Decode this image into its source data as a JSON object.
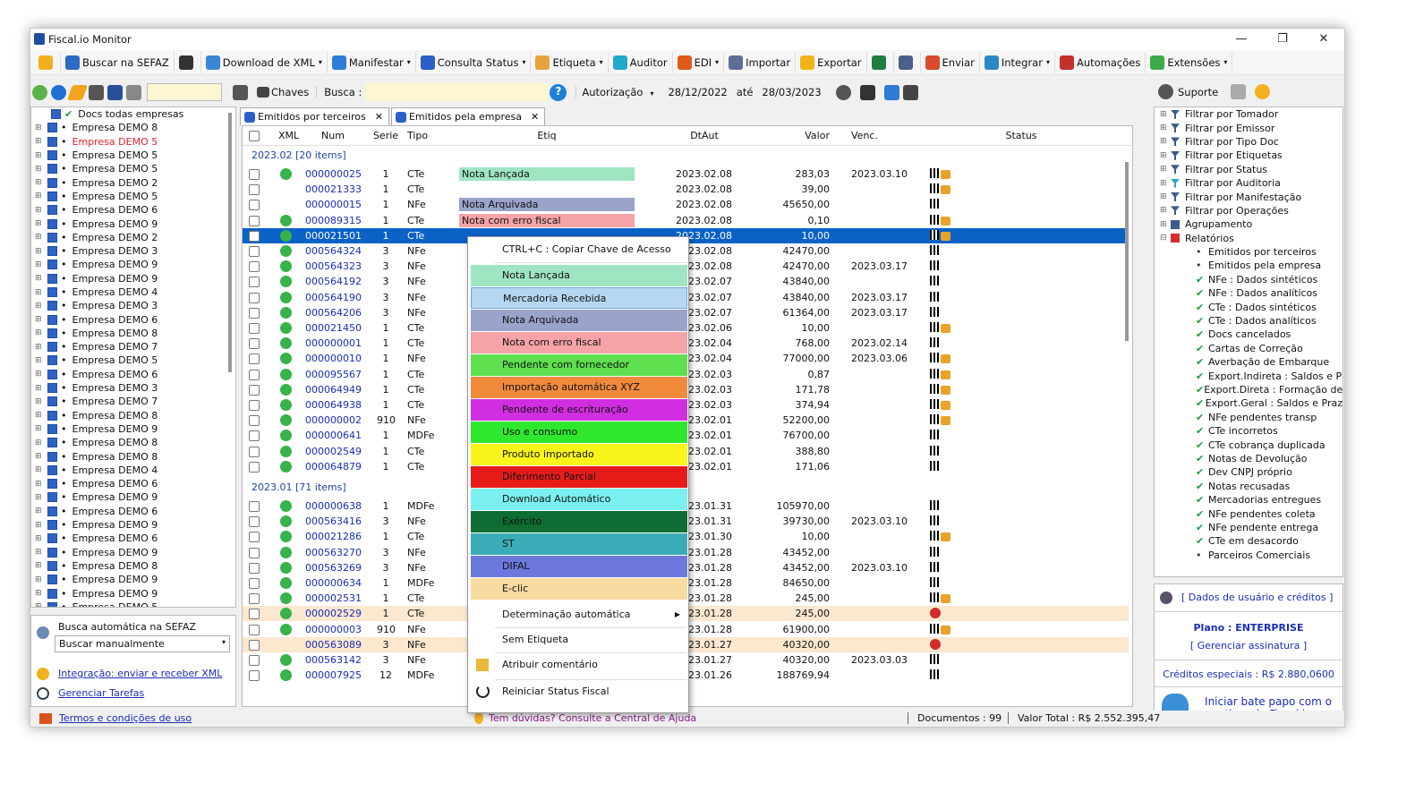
{
  "window": {
    "title": "Fiscal.io Monitor",
    "controls": [
      "—",
      "❐",
      "✕"
    ]
  },
  "toolbar": [
    {
      "label": "",
      "icon": "sun-icon",
      "color": "#f2b01e"
    },
    {
      "label": "Buscar na SEFAZ",
      "icon": "globe-search-icon",
      "color": "#2b6cc4"
    },
    {
      "label": "",
      "icon": "list-icon",
      "color": "#333"
    },
    {
      "label": "Download de XML",
      "icon": "xml-icon",
      "color": "#3a86d4",
      "dd": "▾"
    },
    {
      "label": "Manifestar",
      "icon": "manifest-icon",
      "color": "#2d7cd6",
      "dd": "▾"
    },
    {
      "label": "Consulta Status",
      "icon": "check-status-icon",
      "color": "#2b5fc7",
      "dd": "▾"
    },
    {
      "label": "Etiqueta",
      "icon": "tag-icon",
      "color": "#e8a33d",
      "dd": "▾"
    },
    {
      "label": "Auditor",
      "icon": "auditor-icon",
      "color": "#22a8c9"
    },
    {
      "label": "EDI",
      "icon": "truck-icon",
      "color": "#e05a1b",
      "dd": "▾"
    },
    {
      "label": "Importar",
      "icon": "import-icon",
      "color": "#5c6d9a"
    },
    {
      "label": "Exportar",
      "icon": "export-icon",
      "color": "#f0b41a"
    },
    {
      "label": "",
      "icon": "excel-icon",
      "color": "#1e7d3f"
    },
    {
      "label": "",
      "icon": "printer-icon",
      "color": "#4a5f8a"
    },
    {
      "label": "Enviar",
      "icon": "envelope-icon",
      "color": "#d94b2b"
    },
    {
      "label": "Integrar",
      "icon": "gear-icon",
      "color": "#2b8ac4",
      "dd": "▾"
    },
    {
      "label": "Automações",
      "icon": "automation-icon",
      "color": "#c4302b"
    },
    {
      "label": "Extensões",
      "icon": "extension-icon",
      "color": "#3cab4a",
      "dd": "▾"
    }
  ],
  "toolbar2": {
    "chaves": "Chaves",
    "busca_label": "Busca :",
    "filter": "Autorização",
    "date_from": "28/12/2022",
    "ate": "até",
    "date_to": "28/03/2023",
    "suporte": "Suporte"
  },
  "tabs": [
    {
      "label": "Emitidos por terceiros",
      "close": "✕"
    },
    {
      "label": "Emitidos pela empresa",
      "close": "✕"
    }
  ],
  "left_tree": {
    "root": "Docs todas empresas",
    "items": [
      "Empresa DEMO 8",
      "Empresa DEMO 5",
      "Empresa DEMO 5",
      "Empresa DEMO 5",
      "Empresa DEMO 2",
      "Empresa DEMO 5",
      "Empresa DEMO 6",
      "Empresa DEMO 9",
      "Empresa DEMO 2",
      "Empresa DEMO 3",
      "Empresa DEMO 9",
      "Empresa DEMO 9",
      "Empresa DEMO 4",
      "Empresa DEMO 3",
      "Empresa DEMO 6",
      "Empresa DEMO 8",
      "Empresa DEMO 7",
      "Empresa DEMO 5",
      "Empresa DEMO 6",
      "Empresa DEMO 3",
      "Empresa DEMO 7",
      "Empresa DEMO 8",
      "Empresa DEMO 9",
      "Empresa DEMO 8",
      "Empresa DEMO 8",
      "Empresa DEMO 4",
      "Empresa DEMO 6",
      "Empresa DEMO 9",
      "Empresa DEMO 6",
      "Empresa DEMO 9",
      "Empresa DEMO 6",
      "Empresa DEMO 9",
      "Empresa DEMO 8",
      "Empresa DEMO 9",
      "Empresa DEMO 9",
      "Empresa DEMO 5"
    ],
    "highlight_index": 1,
    "highlight_color": "#e8202a"
  },
  "left_bottom": {
    "auto_label": "Busca automática na SEFAZ",
    "auto_value": "Buscar manualmente",
    "integration": "Integração: enviar e receber XML",
    "tasks": "Gerenciar Tarefas"
  },
  "grid": {
    "columns": [
      "XML",
      "Num",
      "Serie",
      "Tipo",
      "Etiq",
      "DtAut",
      "Valor",
      "Venc.",
      "Status"
    ],
    "groups": [
      {
        "label": "2023.02 [20 items]",
        "rows": [
          {
            "num": "000000025",
            "serie": "1",
            "tipo": "CTe",
            "etiq": "Nota Lançada",
            "etiq_color": "#9fe5c2",
            "dt": "2023.02.08",
            "valor": "283,03",
            "venc": "2023.03.10",
            "xml": true,
            "status": "flag-truck"
          },
          {
            "num": "000021333",
            "serie": "1",
            "tipo": "CTe",
            "etiq": "",
            "dt": "2023.02.08",
            "valor": "39,00",
            "venc": "",
            "xml": false,
            "status": "flag-truck"
          },
          {
            "num": "000000015",
            "serie": "1",
            "tipo": "NFe",
            "etiq": "Nota Arquivada",
            "etiq_color": "#9aa3c9",
            "dt": "2023.02.08",
            "valor": "45650,00",
            "venc": "",
            "xml": false,
            "status": "flag"
          },
          {
            "num": "000089315",
            "serie": "1",
            "tipo": "CTe",
            "etiq": "Nota com erro fiscal",
            "etiq_color": "#f5a3a6",
            "dt": "2023.02.08",
            "valor": "0,10",
            "venc": "",
            "xml": true,
            "status": "flag-truck"
          },
          {
            "num": "000021501",
            "serie": "1",
            "tipo": "CTe",
            "etiq": "",
            "dt": "2023.02.08",
            "valor": "10,00",
            "venc": "",
            "xml": true,
            "status": "flag-truck",
            "selected": true
          },
          {
            "num": "000564324",
            "serie": "3",
            "tipo": "NFe",
            "etiq": "",
            "dt": "2023.02.08",
            "valor": "42470,00",
            "venc": "",
            "xml": true,
            "status": "flag"
          },
          {
            "num": "000564323",
            "serie": "3",
            "tipo": "NFe",
            "etiq": "",
            "dt": "2023.02.08",
            "valor": "42470,00",
            "venc": "2023.03.17",
            "xml": true,
            "status": "flag"
          },
          {
            "num": "000564192",
            "serie": "3",
            "tipo": "NFe",
            "etiq": "",
            "dt": "2023.02.07",
            "valor": "43840,00",
            "venc": "",
            "xml": true,
            "status": "flag"
          },
          {
            "num": "000564190",
            "serie": "3",
            "tipo": "NFe",
            "etiq": "",
            "dt": "2023.02.07",
            "valor": "43840,00",
            "venc": "2023.03.17",
            "xml": true,
            "status": "flag"
          },
          {
            "num": "000564206",
            "serie": "3",
            "tipo": "NFe",
            "etiq": "",
            "dt": "2023.02.07",
            "valor": "61364,00",
            "venc": "2023.03.17",
            "xml": true,
            "status": "flag"
          },
          {
            "num": "000021450",
            "serie": "1",
            "tipo": "CTe",
            "etiq": "",
            "dt": "2023.02.06",
            "valor": "10,00",
            "venc": "",
            "xml": true,
            "status": "flag-truck"
          },
          {
            "num": "000000001",
            "serie": "1",
            "tipo": "CTe",
            "etiq": "",
            "dt": "2023.02.04",
            "valor": "768,00",
            "venc": "2023.02.14",
            "xml": true,
            "status": "flag"
          },
          {
            "num": "000000010",
            "serie": "1",
            "tipo": "NFe",
            "etiq": "",
            "dt": "2023.02.04",
            "valor": "77000,00",
            "venc": "2023.03.06",
            "xml": true,
            "status": "flag-truck"
          },
          {
            "num": "000095567",
            "serie": "1",
            "tipo": "CTe",
            "etiq": "",
            "dt": "2023.02.03",
            "valor": "0,87",
            "venc": "",
            "xml": true,
            "status": "flag-truck"
          },
          {
            "num": "000064949",
            "serie": "1",
            "tipo": "CTe",
            "etiq": "",
            "dt": "2023.02.03",
            "valor": "171,78",
            "venc": "",
            "xml": true,
            "status": "flag-truck"
          },
          {
            "num": "000064938",
            "serie": "1",
            "tipo": "CTe",
            "etiq": "",
            "dt": "2023.02.03",
            "valor": "374,94",
            "venc": "",
            "xml": true,
            "status": "flag-truck"
          },
          {
            "num": "000000002",
            "serie": "910",
            "tipo": "NFe",
            "etiq": "",
            "dt": "2023.02.01",
            "valor": "52200,00",
            "venc": "",
            "xml": true,
            "status": "flag-truck"
          },
          {
            "num": "000000641",
            "serie": "1",
            "tipo": "MDFe",
            "etiq": "",
            "dt": "2023.02.01",
            "valor": "76700,00",
            "venc": "",
            "xml": true,
            "status": "flag"
          },
          {
            "num": "000002549",
            "serie": "1",
            "tipo": "CTe",
            "etiq": "",
            "dt": "2023.02.01",
            "valor": "388,80",
            "venc": "",
            "xml": true,
            "status": "flag"
          },
          {
            "num": "000064879",
            "serie": "1",
            "tipo": "CTe",
            "etiq": "",
            "dt": "2023.02.01",
            "valor": "171,06",
            "venc": "",
            "xml": true,
            "status": "flag"
          }
        ]
      },
      {
        "label": "2023.01 [71 items]",
        "rows": [
          {
            "num": "000000638",
            "serie": "1",
            "tipo": "MDFe",
            "etiq": "",
            "dt": "2023.01.31",
            "valor": "105970,00",
            "venc": "",
            "xml": true,
            "status": "flag"
          },
          {
            "num": "000563416",
            "serie": "3",
            "tipo": "NFe",
            "etiq": "",
            "dt": "2023.01.31",
            "valor": "39730,00",
            "venc": "2023.03.10",
            "xml": true,
            "status": "flag"
          },
          {
            "num": "000021286",
            "serie": "1",
            "tipo": "CTe",
            "etiq": "",
            "dt": "2023.01.30",
            "valor": "10,00",
            "venc": "",
            "xml": true,
            "status": "flag-truck"
          },
          {
            "num": "000563270",
            "serie": "3",
            "tipo": "NFe",
            "etiq": "",
            "dt": "2023.01.28",
            "valor": "43452,00",
            "venc": "",
            "xml": true,
            "status": "flag"
          },
          {
            "num": "000563269",
            "serie": "3",
            "tipo": "NFe",
            "etiq": "",
            "dt": "2023.01.28",
            "valor": "43452,00",
            "venc": "2023.03.10",
            "xml": true,
            "status": "flag"
          },
          {
            "num": "000000634",
            "serie": "1",
            "tipo": "MDFe",
            "etiq": "",
            "dt": "2023.01.28",
            "valor": "84650,00",
            "venc": "",
            "xml": true,
            "status": "flag"
          },
          {
            "num": "000002531",
            "serie": "1",
            "tipo": "CTe",
            "etiq": "",
            "dt": "2023.01.28",
            "valor": "245,00",
            "venc": "",
            "xml": true,
            "status": "flag-truck"
          },
          {
            "num": "000002529",
            "serie": "1",
            "tipo": "CTe",
            "etiq": "",
            "dt": "2023.01.28",
            "valor": "245,00",
            "venc": "",
            "xml": true,
            "status": "error",
            "hl": true
          },
          {
            "num": "000000003",
            "serie": "910",
            "tipo": "NFe",
            "etiq": "",
            "dt": "2023.01.28",
            "valor": "61900,00",
            "venc": "",
            "xml": true,
            "status": "flag-truck"
          },
          {
            "num": "000563089",
            "serie": "3",
            "tipo": "NFe",
            "etiq": "",
            "dt": "2023.01.27",
            "valor": "40320,00",
            "venc": "",
            "xml": false,
            "status": "error",
            "hl": true
          },
          {
            "num": "000563142",
            "serie": "3",
            "tipo": "NFe",
            "etiq": "",
            "dt": "2023.01.27",
            "valor": "40320,00",
            "venc": "2023.03.03",
            "xml": true,
            "status": "flag"
          },
          {
            "num": "000007925",
            "serie": "12",
            "tipo": "MDFe",
            "etiq": "",
            "dt": "2023.01.26",
            "valor": "188769,94",
            "venc": "",
            "xml": true,
            "status": "flag"
          }
        ]
      }
    ]
  },
  "context_menu": {
    "copy": "CTRL+C : Copiar Chave de Acesso",
    "labels": [
      {
        "text": "Nota Lançada",
        "color": "#9fe5c2"
      },
      {
        "text": "Mercadoria Recebida",
        "color": "#b6d6f2"
      },
      {
        "text": "Nota Arquivada",
        "color": "#9aa3c9"
      },
      {
        "text": "Nota com erro fiscal",
        "color": "#f5a3a6"
      },
      {
        "text": "Pendente com fornecedor",
        "color": "#5ee04e"
      },
      {
        "text": "Importação automática XYZ",
        "color": "#f28a3c"
      },
      {
        "text": "Pendente de escrituração",
        "color": "#d02ee0"
      },
      {
        "text": "Uso e consumo",
        "color": "#2ee82e"
      },
      {
        "text": "Produto importado",
        "color": "#f9f51a"
      },
      {
        "text": "Diferimento Parcial",
        "color": "#e81b1b"
      },
      {
        "text": "Download Automático",
        "color": "#7af0f0"
      },
      {
        "text": "Exército",
        "color": "#0d6d32"
      },
      {
        "text": "ST",
        "color": "#3aadb8"
      },
      {
        "text": "DIFAL",
        "color": "#6b78dd"
      },
      {
        "text": "E-clic",
        "color": "#f8dba0"
      }
    ],
    "auto": "Determinação automática",
    "none": "Sem Etiqueta",
    "comment": "Atribuir comentário",
    "restart": "Reiniciar Status Fiscal"
  },
  "right_tree": [
    "Filtrar por Tomador",
    "Filtrar por Emissor",
    "Filtrar por Tipo Doc",
    "Filtrar por Etiquetas",
    "Filtrar por Status",
    "Filtrar por Auditoria",
    "Filtrar por Manifestação",
    "Filtrar por Operações",
    "Agrupamento",
    "Relatórios"
  ],
  "reports": [
    "Emitidos por terceiros",
    "Emitidos pela empresa",
    "NFe : Dados sintéticos",
    "NFe : Dados analíticos",
    "CTe : Dados sintéticos",
    "CTe : Dados analíticos",
    "Docs cancelados",
    "Cartas de Correção",
    "Averbação de Embarque",
    "Export.Indireta : Saldos e P",
    "Export.Direta : Formação de",
    "Export.Geral : Saldos e Praz",
    "NFe pendentes transp",
    "CTe incorretos",
    "CTe cobrança duplicada",
    "Notas de Devolução",
    "Dev CNPJ próprio",
    "Notas recusadas",
    "Mercadorias entregues",
    "NFe pendentes coleta",
    "NFe pendente entrega",
    "CTe em desacordo",
    "Parceiros Comerciais"
  ],
  "right_bottom": {
    "user": "[ Dados de usuário e créditos ]",
    "plan": "Plano : ENTERPRISE",
    "manage": "[ Gerenciar assinatura ]",
    "credits": "Créditos especiais : R$ 2.880,0600",
    "chat": "Iniciar bate papo com o time da Fiscal.io"
  },
  "statusbar": {
    "terms": "Termos e condições de uso",
    "help": "Tem dúvidas? Consulte a Central de Ajuda",
    "docs": "Documentos : 99",
    "total": "Valor Total : R$ 2.552.395,47"
  }
}
